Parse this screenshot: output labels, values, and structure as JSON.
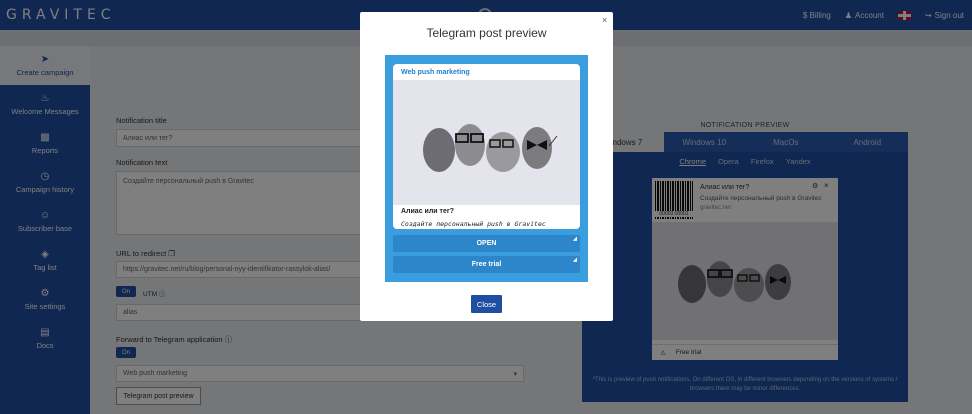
{
  "topbar": {
    "logo": "GRAVITEC",
    "billing": "$ Billing",
    "account": "Account",
    "signout": "Sign out"
  },
  "sidebar": {
    "items": [
      {
        "label": "Create campaign",
        "icon": "send-icon"
      },
      {
        "label": "Welcome Messages",
        "icon": "bell-icon"
      },
      {
        "label": "Reports",
        "icon": "bar-chart-icon"
      },
      {
        "label": "Campaign history",
        "icon": "clock-icon"
      },
      {
        "label": "Subscriber base",
        "icon": "users-icon"
      },
      {
        "label": "Tag list",
        "icon": "tag-icon"
      },
      {
        "label": "Site settings",
        "icon": "gear-icon"
      },
      {
        "label": "Docs",
        "icon": "document-icon"
      }
    ]
  },
  "form": {
    "notification_title_label": "Notification title",
    "notification_title_value": "Алиас или тег?",
    "notification_text_label": "Notification text",
    "notification_text_value": "Создайте персональный push в Gravitec",
    "url_label": "URL to redirect",
    "url_value": "https://gravitec.net/ru/blog/personal-nyy-identifikator-rassylok-alias/",
    "utm_toggle": "On",
    "utm_label": "UTM",
    "alias_value": "alias",
    "telegram_label": "Forward to Telegram application",
    "telegram_toggle": "On",
    "telegram_select": "Web push marketing",
    "preview_button": "Telegram post preview"
  },
  "notification_preview": {
    "title": "NOTIFICATION PREVIEW",
    "os_tabs": [
      "Windows 7",
      "Windows 10",
      "MacOs",
      "Android"
    ],
    "active_os": "Windows 7",
    "browsers": [
      "Chrome",
      "Opera",
      "Firefox",
      "Yandex"
    ],
    "active_browser": "Chrome",
    "card_title": "Алиас или тег?",
    "card_text": "Создайте персональный push в Gravitec",
    "card_domain": "gravitec.net",
    "barcode_text": "00003 00001",
    "footer_button": "Free trial",
    "note": "*This is preview of push notifications. On different OS, in different browsers depending on the versions of systems / browsers there may be minor differences."
  },
  "modal": {
    "title": "Telegram post preview",
    "close_x": "×",
    "channel": "Web push marketing",
    "post_title": "Алиас или тег?",
    "post_text": "Создайте персональный push в Gravitec",
    "button_open": "OPEN",
    "button_trial": "Free trial",
    "close_button": "Close"
  }
}
